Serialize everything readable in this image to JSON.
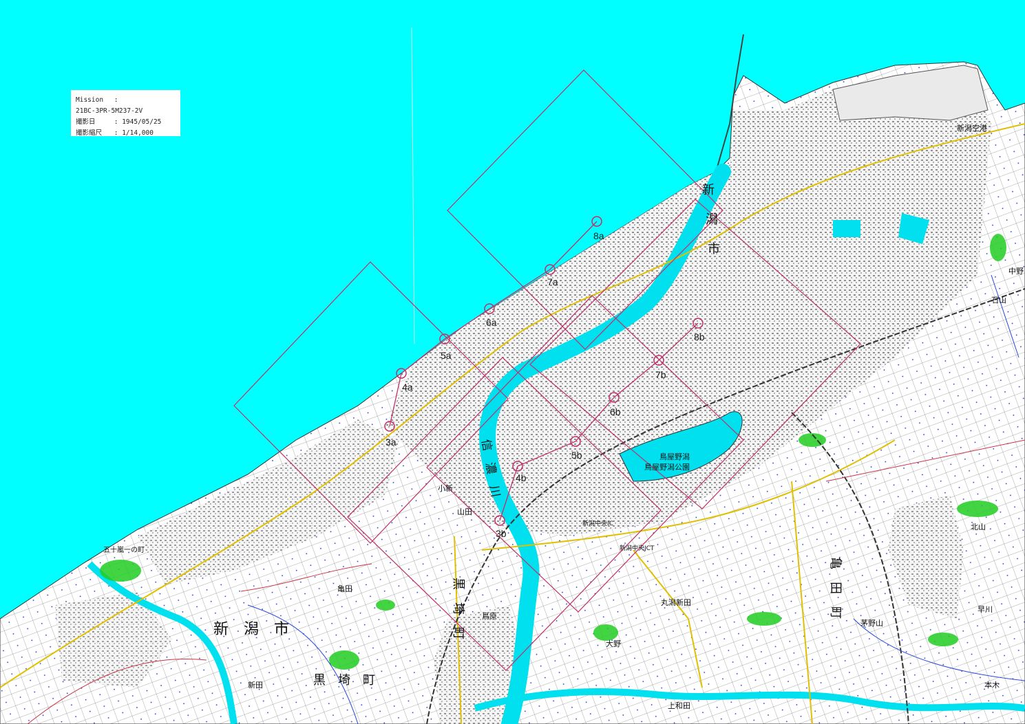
{
  "info_box": {
    "mission_key": "Mission",
    "mission_sep": ":",
    "mission_value": "21BC-3PR-5M237-2V",
    "date_key": "撮影日",
    "date_sep": ":",
    "date_value": "1945/05/25",
    "scale_key": "撮影縮尺",
    "scale_sep": ":",
    "scale_value": "1/14,000"
  },
  "photo_points": [
    {
      "label": "3a"
    },
    {
      "label": "4a"
    },
    {
      "label": "5a"
    },
    {
      "label": "6a"
    },
    {
      "label": "7a"
    },
    {
      "label": "8a"
    },
    {
      "label": "3b"
    },
    {
      "label": "4b"
    },
    {
      "label": "5b"
    },
    {
      "label": "6b"
    },
    {
      "label": "7b"
    },
    {
      "label": "8b"
    }
  ],
  "map_labels": {
    "city_main": "新　潟　市",
    "city_upper1": "新",
    "city_upper2": "潟",
    "city_upper3": "市",
    "river": "信　濃　川",
    "town_kameda": "亀　田　町",
    "town_kurosaki1": "黒　埼　町",
    "town_kurosaki2": "黒　埼　町",
    "park": "鳥屋野潟公園",
    "lake": "鳥屋野潟",
    "district_ikarashi": "五十嵐一の町",
    "airport": "新潟空港",
    "area_oyama": "小新",
    "area_yamada": "山田",
    "area_kamiyama": "亀田",
    "area_maruyama": "丸潟新田",
    "area_ookawa": "大野",
    "area_kitayama": "北山",
    "area_nakanokuchi": "中野",
    "area_kayama": "茅野山",
    "area_hayakawa": "早川",
    "area_kinoshita": "本木",
    "area_ishiyama": "石山",
    "area_torinoya": "鳥原",
    "area_shinden": "新田",
    "area_kami": "上和田",
    "interchange": "新潟中央IC",
    "jct": "新潟中央JCT"
  },
  "colors": {
    "sea": "#00ffff",
    "land": "#ffffff",
    "frame": "#c0306a",
    "road": "#e0c000",
    "green": "#22cc22",
    "river": "#00e0ee"
  }
}
